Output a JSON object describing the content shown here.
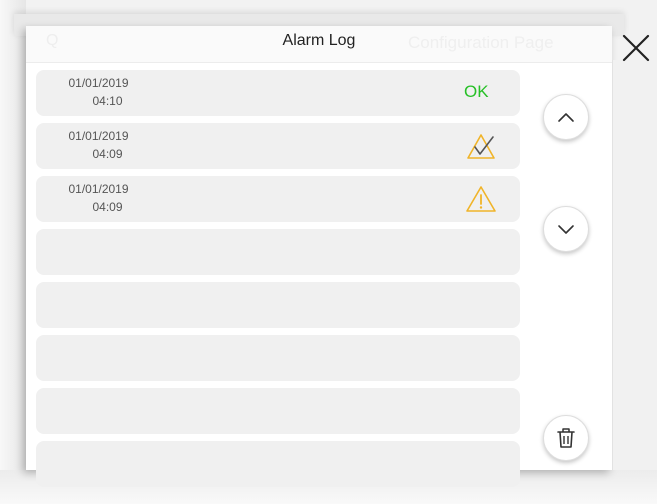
{
  "header": {
    "title": "Alarm Log",
    "ghost_left": "Q",
    "ghost_right": "Configuration Page"
  },
  "rows": [
    {
      "date": "01/01/2019",
      "time": "04:10",
      "status_icon": "ok-text",
      "status_text": "OK"
    },
    {
      "date": "01/01/2019",
      "time": "04:09",
      "status_icon": "warning-acknowledged-icon"
    },
    {
      "date": "01/01/2019",
      "time": "04:09",
      "status_icon": "warning-icon"
    },
    {
      "date": "",
      "time": ""
    },
    {
      "date": "",
      "time": ""
    },
    {
      "date": "",
      "time": ""
    },
    {
      "date": "",
      "time": ""
    },
    {
      "date": "",
      "time": ""
    }
  ],
  "controls": {
    "scroll_up": "chevron-up-icon",
    "scroll_down": "chevron-down-icon",
    "delete": "trash-icon",
    "close": "close-icon"
  },
  "colors": {
    "ok": "#27c027",
    "warning": "#f0b429",
    "row_bg": "#f0f0f0"
  }
}
